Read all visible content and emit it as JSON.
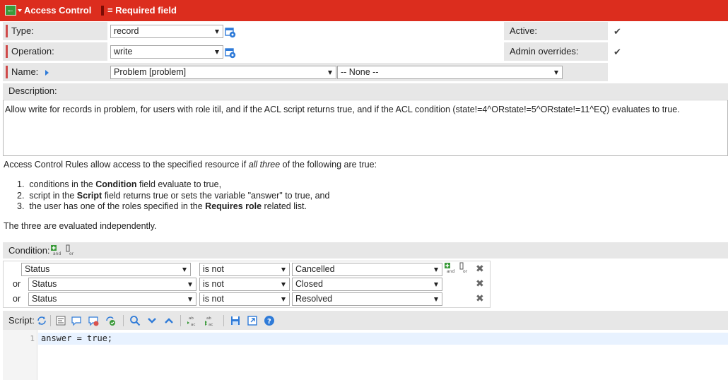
{
  "header": {
    "back_glyph": "←",
    "title": "Access Control",
    "required_legend": "= Required field"
  },
  "fields": {
    "type": {
      "label": "Type:",
      "value": "record"
    },
    "operation": {
      "label": "Operation:",
      "value": "write"
    },
    "name": {
      "label": "Name:",
      "table_value": "Problem [problem]",
      "field_value": "-- None --"
    },
    "active": {
      "label": "Active:",
      "checked": true
    },
    "admin_overrides": {
      "label": "Admin overrides:",
      "checked": true
    }
  },
  "description": {
    "label": "Description:",
    "text": "Allow write for records in problem, for users with role itil, and if the ACL script returns true, and if the ACL condition (state!=4^ORstate!=5^ORstate!=11^EQ) evaluates to true."
  },
  "info": {
    "intro_before": "Access Control Rules allow access to the specified resource if ",
    "intro_em": "all three",
    "intro_after": " of the following are true:",
    "items": [
      {
        "num": "1.",
        "before": "conditions in the ",
        "bold": "Condition",
        "after": " field evaluate to true,"
      },
      {
        "num": "2.",
        "before": "script in the ",
        "bold": "Script",
        "after": " field returns true or sets the variable \"answer\" to true, and"
      },
      {
        "num": "3.",
        "before": "the user has one of the roles specified in the ",
        "bold": "Requires role",
        "after": " related list."
      }
    ],
    "closing": "The three are evaluated independently."
  },
  "condition": {
    "label": "Condition:",
    "rows": [
      {
        "prefix": "",
        "field": "Status",
        "operator": "is not",
        "value": "Cancelled"
      },
      {
        "prefix": "or",
        "field": "Status",
        "operator": "is not",
        "value": "Closed"
      },
      {
        "prefix": "or",
        "field": "Status",
        "operator": "is not",
        "value": "Resolved"
      }
    ]
  },
  "script": {
    "label": "Script:",
    "line_number": "1",
    "code": "answer = true;"
  },
  "colors": {
    "header_bg": "#dc2d1e",
    "required_marker": "#cf4a4a",
    "panel_bg": "#e7e7e7",
    "accent_blue": "#2f7bd8",
    "add_green": "#3a9a3a"
  },
  "icons": {
    "back": "back-arrow-icon",
    "reference": "reference-lookup-icon",
    "name_arrow": "expand-arrow-icon",
    "add_and": "add-and-condition-icon",
    "add_or": "add-or-condition-icon",
    "delete": "delete-condition-icon",
    "toolbar": [
      "toggle-syntax-icon",
      "format-code-icon",
      "comment-icon",
      "uncomment-icon",
      "check-syntax-icon",
      "search-icon",
      "find-next-icon",
      "find-previous-icon",
      "replace-icon",
      "replace-all-icon",
      "save-icon",
      "fullscreen-icon",
      "help-icon"
    ]
  }
}
